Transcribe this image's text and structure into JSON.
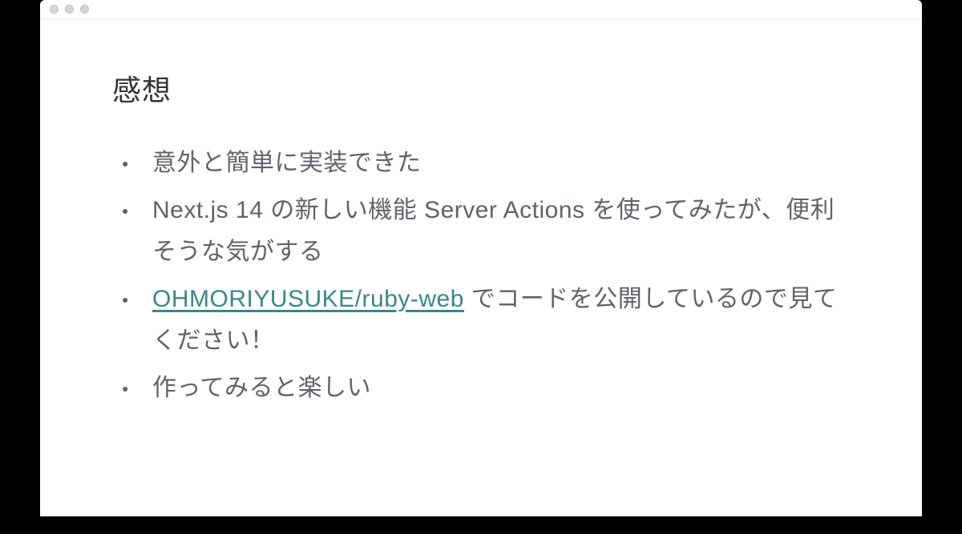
{
  "slide": {
    "title": "感想",
    "bullets": {
      "b1": "意外と簡単に実装できた",
      "b2": "Next.js 14 の新しい機能 Server Actions を使ってみたが、便利そうな気がする",
      "b3_link": "OHMORIYUSUKE/ruby-web",
      "b3_rest": " でコードを公開しているので見てください！",
      "b4": "作ってみると楽しい"
    }
  },
  "colors": {
    "link": "#3b8686",
    "text": "#5f6367",
    "title": "#333333"
  }
}
